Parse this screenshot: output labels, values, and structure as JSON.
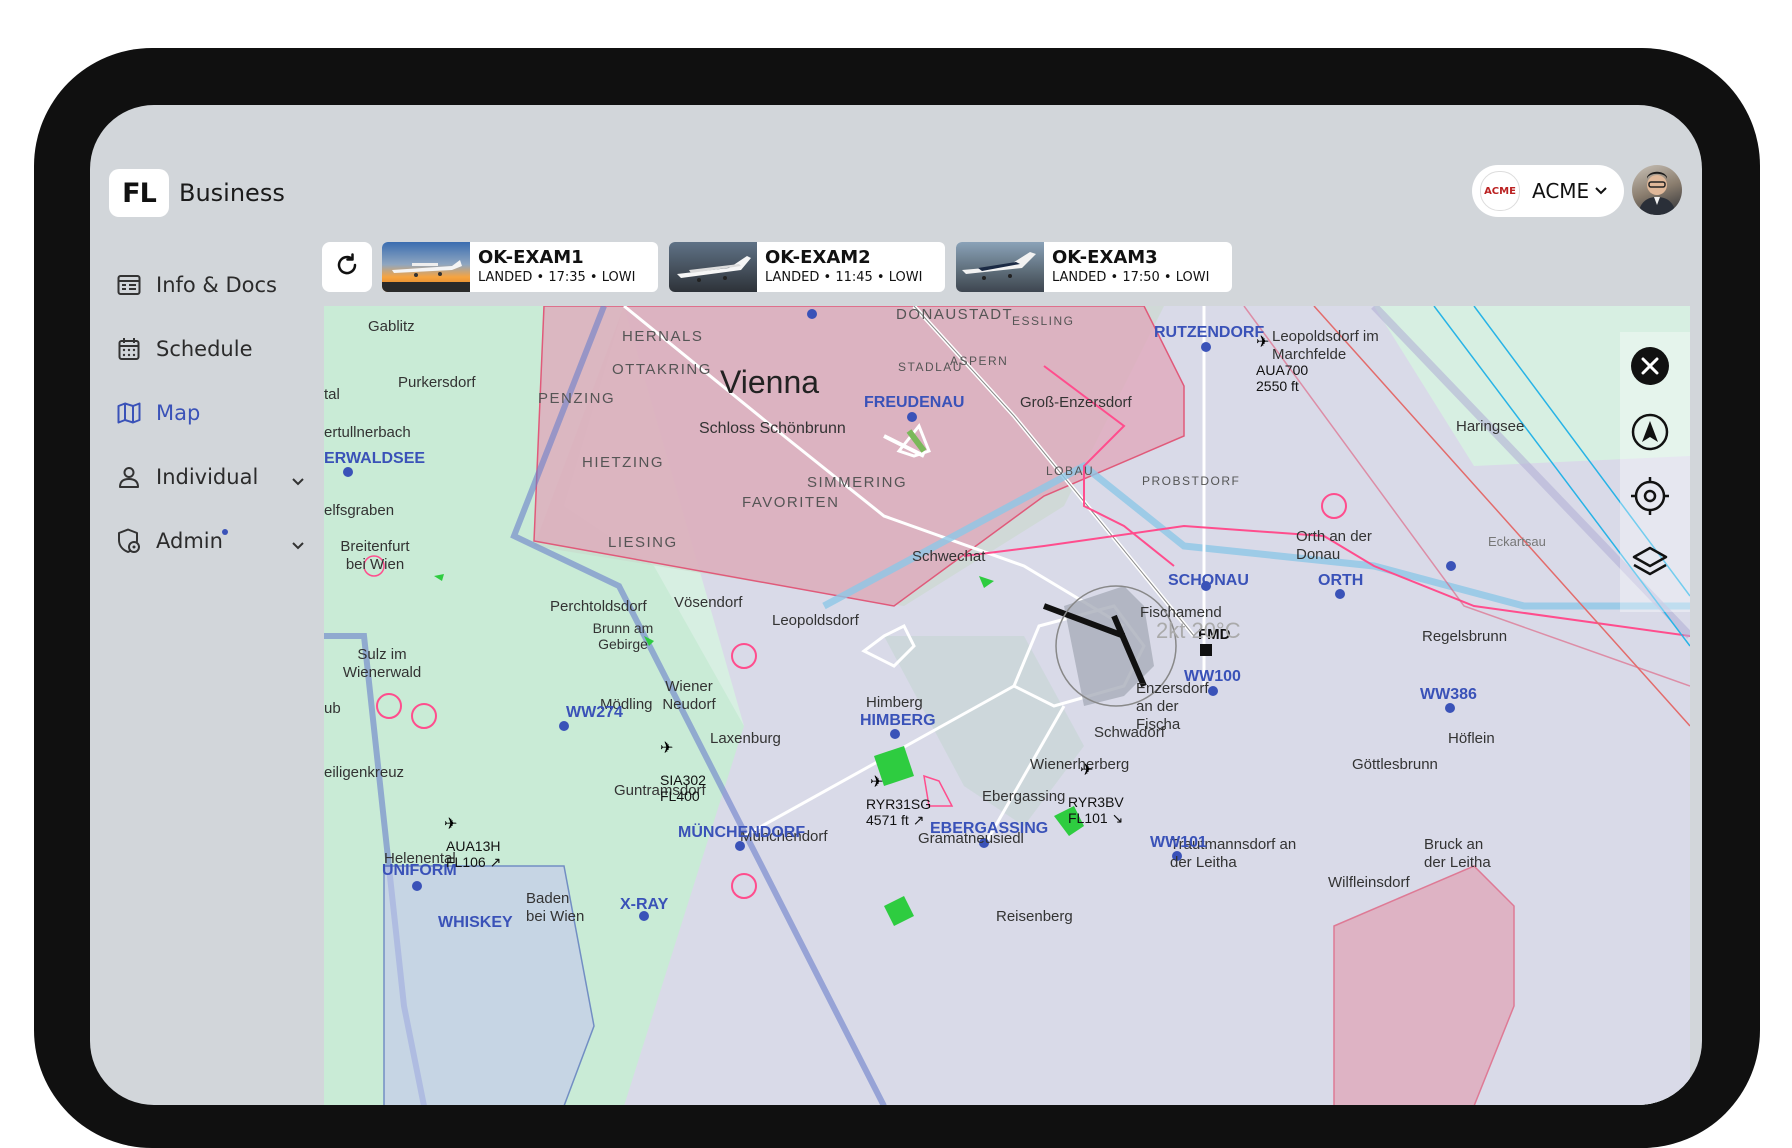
{
  "app": {
    "logo_mark": "FL",
    "logo_text": "Business"
  },
  "nav": [
    {
      "label": "Info & Docs",
      "icon": "info-docs-icon",
      "active": false,
      "has_chevron": false
    },
    {
      "label": "Schedule",
      "icon": "calendar-icon",
      "active": false,
      "has_chevron": false
    },
    {
      "label": "Map",
      "icon": "map-icon",
      "active": true,
      "has_chevron": false
    },
    {
      "label": "Individual",
      "icon": "person-icon",
      "active": false,
      "has_chevron": true
    },
    {
      "label": "Admin",
      "icon": "admin-icon",
      "active": false,
      "has_chevron": true,
      "badge_dot": true
    }
  ],
  "account": {
    "badge": "ACME",
    "name": "ACME"
  },
  "aircraft": [
    {
      "reg": "OK-EXAM1",
      "status": "LANDED • 17:35 • LOWI"
    },
    {
      "reg": "OK-EXAM2",
      "status": "LANDED • 11:45 • LOWI"
    },
    {
      "reg": "OK-EXAM3",
      "status": "LANDED • 17:50 • LOWI"
    }
  ],
  "map": {
    "city": "Vienna",
    "districts": [
      "HERNALS",
      "OTTAKRING",
      "PENZING",
      "HIETZING",
      "FAVORITEN",
      "SIMMERING",
      "LIESING",
      "DONAUSTADT",
      "ESSLING",
      "STADLAU",
      "ASPERN",
      "LOBAU",
      "PROBSTDORF"
    ],
    "places": [
      "Gablitz",
      "Purkersdorf",
      "Breitenfurt bei Wien",
      "Perchtoldsdorf",
      "Vösendorf",
      "Leopoldsdorf",
      "Schwechat",
      "Fischamend",
      "Himberg",
      "Laxenburg",
      "Mödling",
      "Wiener Neudorf",
      "Brunn am Gebirge",
      "Sulz im Wienerwald",
      "Schwadorf",
      "Wienerherberg",
      "Ebergassing",
      "Gramatneusiedl",
      "Münchendorf",
      "Guntramsdorf",
      "Baden bei Wien",
      "Groß-Enzersdorf",
      "Leopoldsdorf im Marchfelde",
      "Orth an der Donau",
      "Regelsbrunn",
      "Höflein",
      "Göttlesbrunn",
      "Bruck an der Leitha",
      "Trautmannsdorf an der Leitha",
      "Wilfleinsdorf",
      "Reisenberg",
      "Enzersdorf an der Fischa",
      "Haringsee",
      "Eckartsau",
      "Helenental",
      "Schloss Schönbrunn"
    ],
    "partial_places": [
      "tal",
      "ertullnerbach",
      "elfsgraben",
      "ub",
      "eiligenkreuz"
    ],
    "reporting_points": [
      "RUTZENDORF",
      "FREUDENAU",
      "SCHONAU",
      "ORTH",
      "WW100",
      "WW386",
      "WW274",
      "HIMBERG",
      "EBERGASSING",
      "MÜNCHENDORF",
      "WW101",
      "UNIFORM",
      "X-RAY",
      "WHISKEY"
    ],
    "partial_points": [
      "ERWALDSEE"
    ],
    "airport": {
      "code": "FMD",
      "wind": "2kt 20°C"
    },
    "traffic": [
      {
        "callsign": "AUA700",
        "info": "2550 ft"
      },
      {
        "callsign": "SIA302",
        "info": "FL400"
      },
      {
        "callsign": "RYR31SG",
        "info": "4571 ft ↗"
      },
      {
        "callsign": "RYR3BV",
        "info": "FL101 ↘"
      },
      {
        "callsign": "AUA13H",
        "info": "FL106 ↗"
      }
    ]
  },
  "map_controls": [
    "close-icon",
    "navigation-arrow-icon",
    "locate-icon",
    "layers-icon"
  ]
}
